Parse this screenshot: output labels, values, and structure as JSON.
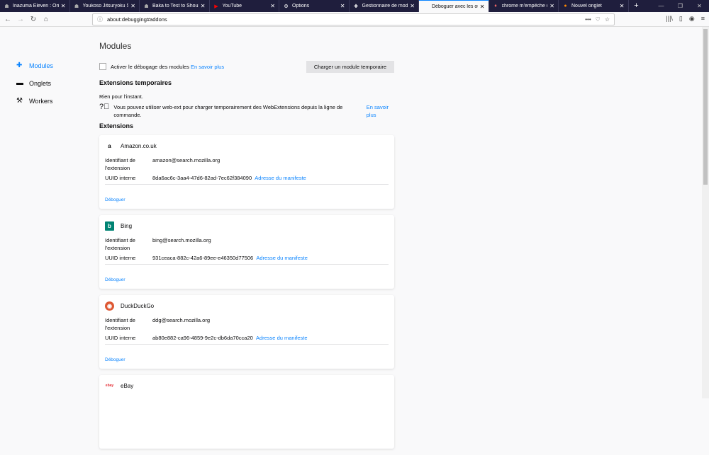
{
  "tabs": [
    {
      "title": "Inazuma Eleven : Orion no Kokuin",
      "icon": "ghost-icon"
    },
    {
      "title": "Youkoso Jitsuryoku Shijou",
      "icon": "ghost-icon"
    },
    {
      "title": "Baka to Test to Shoukanjuu",
      "icon": "ghost-icon"
    },
    {
      "title": "YouTube",
      "icon": "youtube-icon"
    },
    {
      "title": "Options",
      "icon": "gear-icon"
    },
    {
      "title": "Gestionnaire de modules",
      "icon": "puzzle-icon"
    },
    {
      "title": "Déboguer avec les outils de développement",
      "icon": "",
      "active": true
    },
    {
      "title": "chrome m'empêche de",
      "icon": "fire-icon"
    },
    {
      "title": "Nouvel onglet",
      "icon": "firefox-icon"
    }
  ],
  "url": "about:debugging#addons",
  "sidebar": [
    {
      "label": "Modules"
    },
    {
      "label": "Onglets"
    },
    {
      "label": "Workers"
    }
  ],
  "main": {
    "title": "Modules",
    "enable_debug": "Activer le débogage des modules",
    "learn_more": "En savoir plus",
    "load_button": "Charger un module temporaire",
    "temp_heading": "Extensions temporaires",
    "nothing": "Rien pour l'instant.",
    "webext_hint": "Vous pouvez utiliser web-ext pour charger temporairement des WebExtensions depuis la ligne de commande.",
    "learn_more2": "En savoir plus",
    "ext_heading": "Extensions",
    "id_label": "Identifiant de l'extension",
    "uuid_label": "UUID interne",
    "manifest_link": "Adresse du manifeste",
    "debug_link": "Déboguer"
  },
  "extensions": [
    {
      "name": "Amazon.co.uk",
      "id": "amazon@search.mozilla.org",
      "uuid": "8da6ac6c-3aa4-47d6-82ad-7ec62f384090"
    },
    {
      "name": "Bing",
      "id": "bing@search.mozilla.org",
      "uuid": "931ceaca-882c-42a6-89ee-e46350d77506"
    },
    {
      "name": "DuckDuckGo",
      "id": "ddg@search.mozilla.org",
      "uuid": "ab80e882-ca96-4859-9e2c-db6da70cca20"
    },
    {
      "name": "eBay"
    }
  ]
}
